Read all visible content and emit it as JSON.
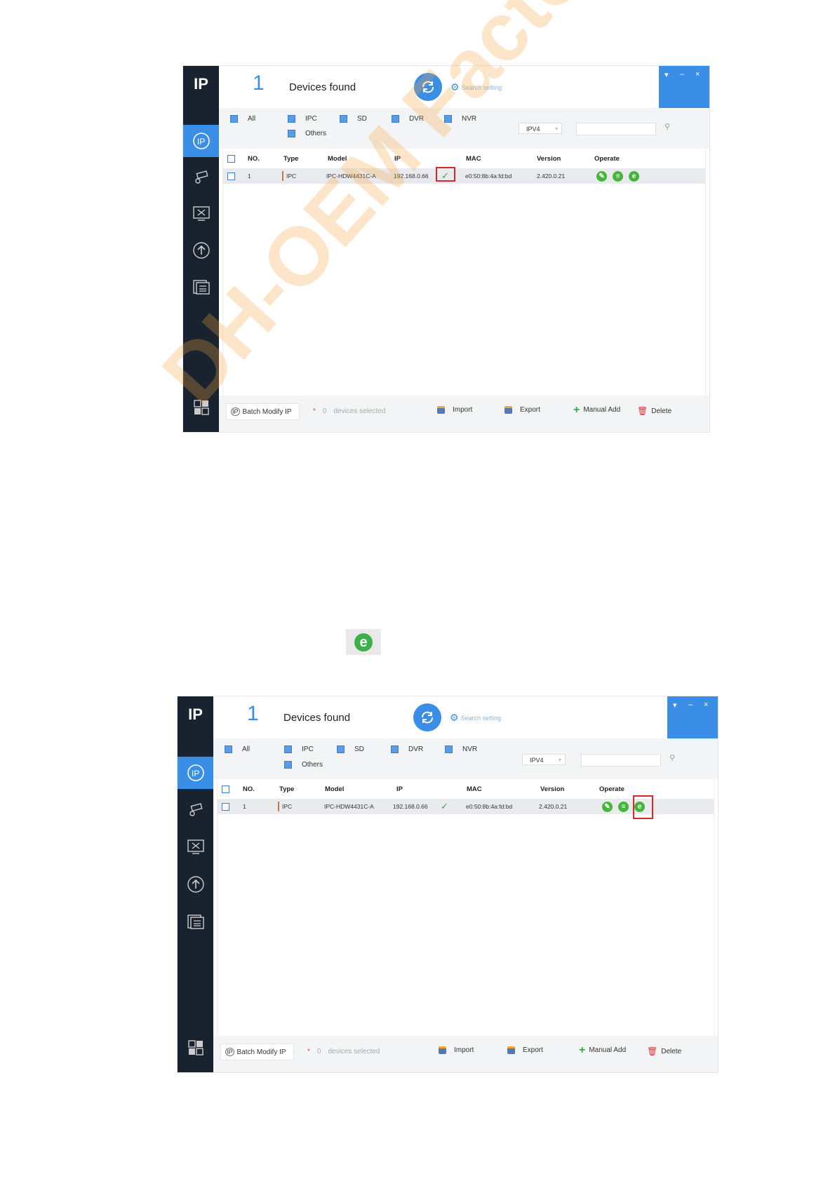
{
  "app": {
    "logo_text": "IP",
    "count": "1",
    "devices_found": "Devices found",
    "search_setting": "Search setting",
    "window_controls": [
      "▾",
      "–",
      "×"
    ]
  },
  "filters": {
    "all": "All",
    "ipc": "IPC",
    "sd": "SD",
    "dvr": "DVR",
    "nvr": "NVR",
    "others": "Others",
    "ip_version": "IPV4",
    "search_value": ""
  },
  "table": {
    "columns": [
      "NO.",
      "Type",
      "Model",
      "IP",
      "MAC",
      "Version",
      "Operate"
    ],
    "rows": [
      {
        "no": "1",
        "type": "IPC",
        "model": "IPC-HDW4431C-A",
        "ip": "192.168.0.66",
        "mac": "e0:50:8b:4a:fd:bd",
        "version": "2.420.0.21"
      }
    ]
  },
  "footer": {
    "batch_modify": "Batch Modify IP",
    "star": "*",
    "selected_count": "0",
    "devices_selected": "devices selected",
    "import": "Import",
    "export": "Export",
    "manual_add": "Manual Add",
    "delete": "Delete"
  },
  "watermark": "DH-OEM Factory",
  "colors": {
    "sidebar": "#18232f",
    "accent": "#3a8ee6",
    "ok_green": "#36a94a",
    "highlight_red": "#d9262c",
    "watermark": "#f7a440"
  },
  "icons": [
    "ip-logo-icon",
    "ip-config-icon",
    "camera-icon",
    "tools-icon",
    "upgrade-icon",
    "docs-icon",
    "apps-icon",
    "refresh-icon",
    "gear-icon",
    "search-icon",
    "edit-icon",
    "detail-icon",
    "ie-browser-icon"
  ]
}
